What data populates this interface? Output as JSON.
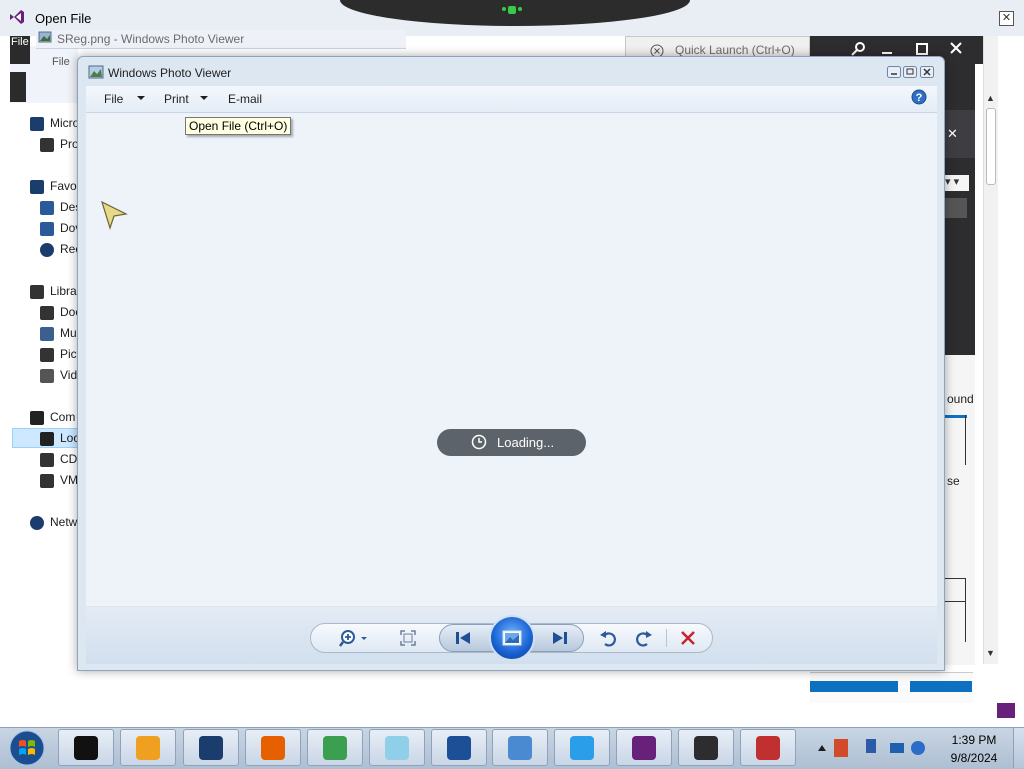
{
  "open_file_dialog": {
    "title": "Open File",
    "close_glyph": "✕"
  },
  "background_window": {
    "title": "SReg.png - Windows Photo Viewer",
    "file_tab": "File",
    "file_menu": "File"
  },
  "visual_studio": {
    "quick_launch_placeholder": "Quick Launch (Ctrl+O)",
    "panel_text_bound": "ound",
    "panel_text_se": "se",
    "panel_close": "✕",
    "panel_dropdown": "▾ ▾"
  },
  "nav_pane": {
    "items": [
      {
        "label": "Micro",
        "icon": "vs-icon"
      },
      {
        "label": "Pro",
        "icon": "file-icon"
      },
      {
        "label": "Favor",
        "icon": "star-icon"
      },
      {
        "label": "Des",
        "icon": "desktop-icon"
      },
      {
        "label": "Dov",
        "icon": "downloads-icon"
      },
      {
        "label": "Rec",
        "icon": "recent-icon"
      },
      {
        "label": "Libra",
        "icon": "library-icon"
      },
      {
        "label": "Doc",
        "icon": "documents-icon"
      },
      {
        "label": "Mu",
        "icon": "music-icon"
      },
      {
        "label": "Pict",
        "icon": "pictures-icon"
      },
      {
        "label": "Vid",
        "icon": "videos-icon"
      },
      {
        "label": "Com",
        "icon": "computer-icon"
      },
      {
        "label": "Loc",
        "icon": "local-disk-icon"
      },
      {
        "label": "CD",
        "icon": "cd-drive-icon"
      },
      {
        "label": "VM",
        "icon": "vm-drive-icon"
      },
      {
        "label": "Netw",
        "icon": "network-icon"
      }
    ]
  },
  "photo_viewer": {
    "title": "Windows Photo Viewer",
    "menu": {
      "file": "File",
      "print": "Print",
      "email": "E-mail"
    },
    "tooltip": "Open File (Ctrl+O)",
    "loading_text": "Loading...",
    "help_glyph": "?",
    "toolbar": {
      "zoom": "zoom-icon",
      "actual_size": "actual-size-icon",
      "previous": "previous-icon",
      "slideshow": "slideshow-icon",
      "next": "next-icon",
      "rotate_ccw": "rotate-counterclockwise-icon",
      "rotate_cw": "rotate-clockwise-icon",
      "delete": "delete-icon"
    }
  },
  "taskbar": {
    "apps": [
      "terminal",
      "media-player",
      "globe-app",
      "firefox",
      "paint-app",
      "notes-app",
      "phone-app",
      "photos-app",
      "internet-explorer",
      "visual-studio",
      "remote-desktop",
      "java-app"
    ],
    "time": "1:39 PM",
    "date": "9/8/2024"
  },
  "colors": {
    "accent": "#0e70c0",
    "vs_purple": "#68217a",
    "loading_bg": "#5c636b"
  }
}
